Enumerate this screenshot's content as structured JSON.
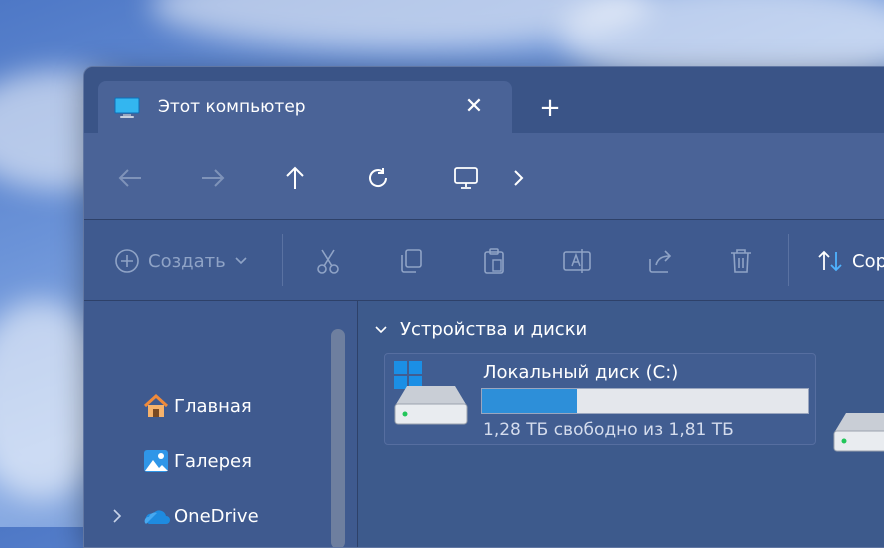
{
  "tab": {
    "title": "Этот компьютер"
  },
  "toolbar": {
    "create_label": "Создать",
    "sort_label": "Сор"
  },
  "sidebar": {
    "items": [
      {
        "label": "Главная",
        "icon": "home-icon"
      },
      {
        "label": "Галерея",
        "icon": "gallery-icon"
      },
      {
        "label": "OneDrive",
        "icon": "onedrive-icon"
      }
    ]
  },
  "content": {
    "group_header": "Устройства и диски",
    "drives": [
      {
        "name": "Локальный диск (C:)",
        "free_text": "1,28 ТБ свободно из 1,81 ТБ",
        "used_fraction": 0.29
      }
    ]
  },
  "colors": {
    "accent": "#2d8fd9",
    "window_bg": "#3f5a8f"
  }
}
